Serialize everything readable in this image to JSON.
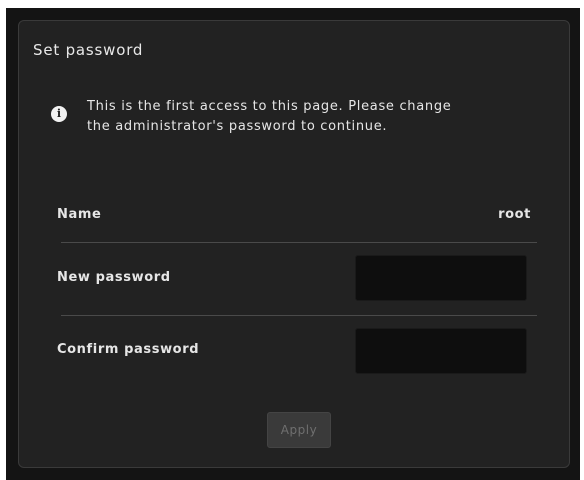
{
  "dialog": {
    "title": "Set password",
    "notice": {
      "icon": "info-icon",
      "text": "This is the first access to this page. Please change\nthe administrator's password to continue."
    },
    "fields": {
      "name_label": "Name",
      "name_value": "root",
      "new_password_label": "New password",
      "new_password_value": "",
      "confirm_password_label": "Confirm password",
      "confirm_password_value": ""
    },
    "apply_label": "Apply",
    "apply_state": "disabled"
  },
  "colors": {
    "frame_background": "#141414",
    "dialog_background": "#222222",
    "input_background": "#0e0e0e",
    "text": "#e6e6e6",
    "button_disabled": "#3a3a3a"
  }
}
